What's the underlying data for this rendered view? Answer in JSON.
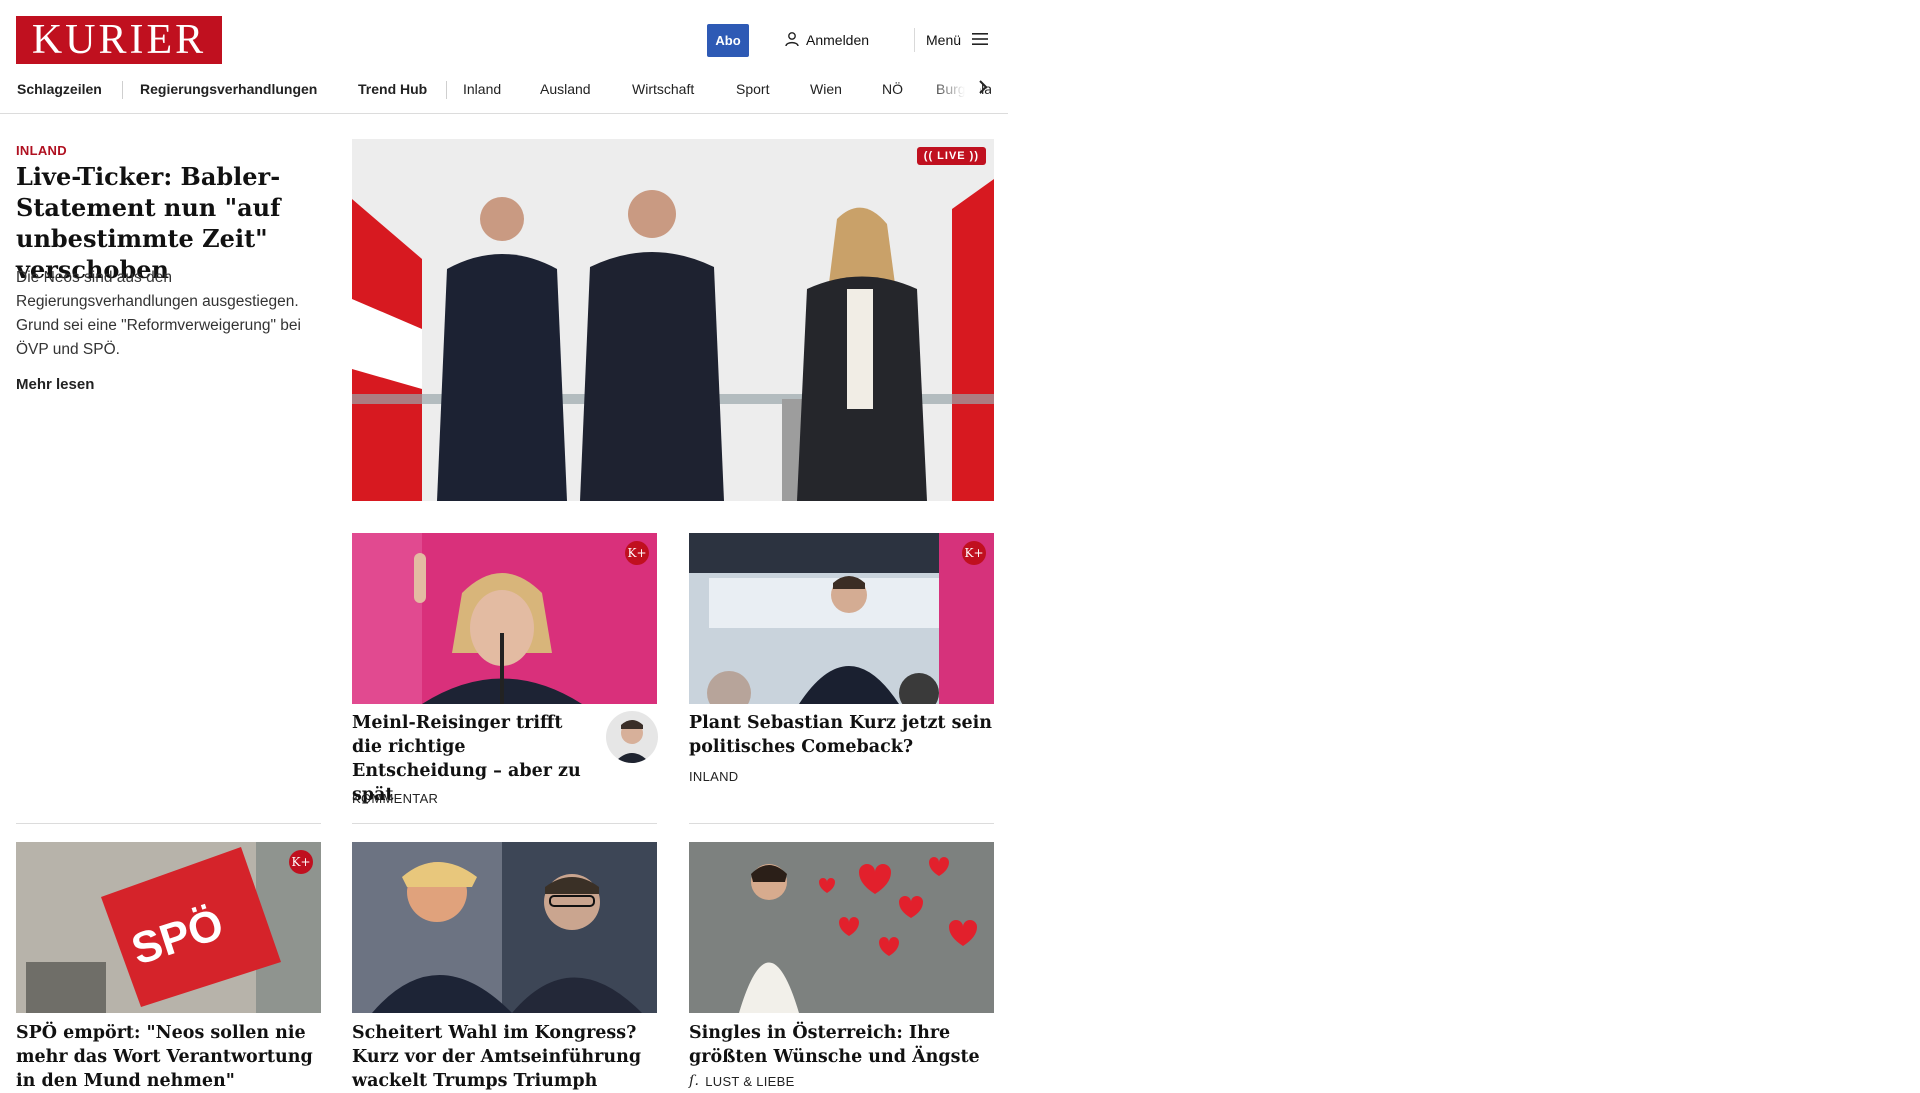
{
  "header": {
    "logo_text": "KURIER",
    "abo_label": "Abo",
    "login_label": "Anmelden",
    "menu_label": "Menü"
  },
  "nav": {
    "items": [
      "Schlagzeilen",
      "Regierungsverhandlungen",
      "Trend Hub",
      "Inland",
      "Ausland",
      "Wirtschaft",
      "Sport",
      "Wien",
      "NÖ",
      "Burgenland"
    ]
  },
  "lead": {
    "kicker": "INLAND",
    "title": "Live-Ticker: Babler-State­ment nun \"auf unbe­stimmte Zeit\" verschoben",
    "teaser": "Die Neos sind aus den Regierungsverhandlungen ausgestiegen. Grund sei eine \"Reformverweigerung\" bei ÖVP und SPÖ.",
    "more_label": "Mehr lesen",
    "live_label": "(( LIVE ))"
  },
  "cards": [
    {
      "title": "Meinl-Reisinger trifft die richtige Entscheidung – aber zu spät",
      "tag": "KOMMENTAR",
      "badge": "K+"
    },
    {
      "title": "Plant Sebastian Kurz jetzt sein po­litisches Comeback?",
      "tag": "INLAND",
      "badge": "K+"
    },
    {
      "title": "SPÖ empört: \"Neos sollen nie mehr das Wort Verantwortung in den Mund nehmen\"",
      "tag": "",
      "badge": "K+",
      "sign_text": "SPÖ"
    },
    {
      "title": "Scheitert Wahl im Kongress? Kurz vor der Amtseinführung wackelt Trumps Triumph",
      "tag": "",
      "badge": ""
    },
    {
      "title": "Singles in Österreich: Ihre größten Wünsche und Ängste",
      "tag": "LUST & LIEBE",
      "badge": ""
    }
  ],
  "colors": {
    "brand_red": "#c0101f",
    "abo_blue": "#2e5ab5",
    "kicker_red": "#b01020"
  },
  "icons": [
    "user-icon",
    "hamburger-menu-icon",
    "chevron-right-icon",
    "kplus-badge-icon",
    "lust-liebe-icon"
  ]
}
